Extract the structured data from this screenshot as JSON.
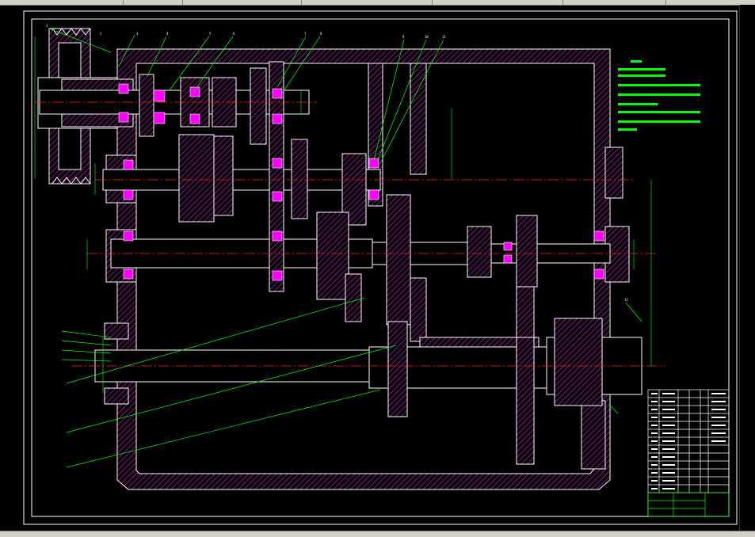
{
  "window": {
    "title": "",
    "toolbar_segments": [
      "",
      "",
      "",
      "",
      "",
      "",
      ""
    ]
  },
  "drawing": {
    "technical_notes_heading": "",
    "technical_notes": [
      "",
      "",
      "",
      "",
      "",
      "",
      "",
      ""
    ],
    "part_callouts": [
      "1",
      "2",
      "3",
      "4",
      "5",
      "6",
      "7",
      "8",
      "9",
      "10",
      "11",
      "12"
    ],
    "colors": {
      "background": "#000000",
      "outline": "#ffffff",
      "hatch": "#ff00ff",
      "dimension": "#00ff00",
      "centerline": "#ff0000",
      "bearing": "#ff00ff",
      "frame": "#ffffff"
    }
  }
}
